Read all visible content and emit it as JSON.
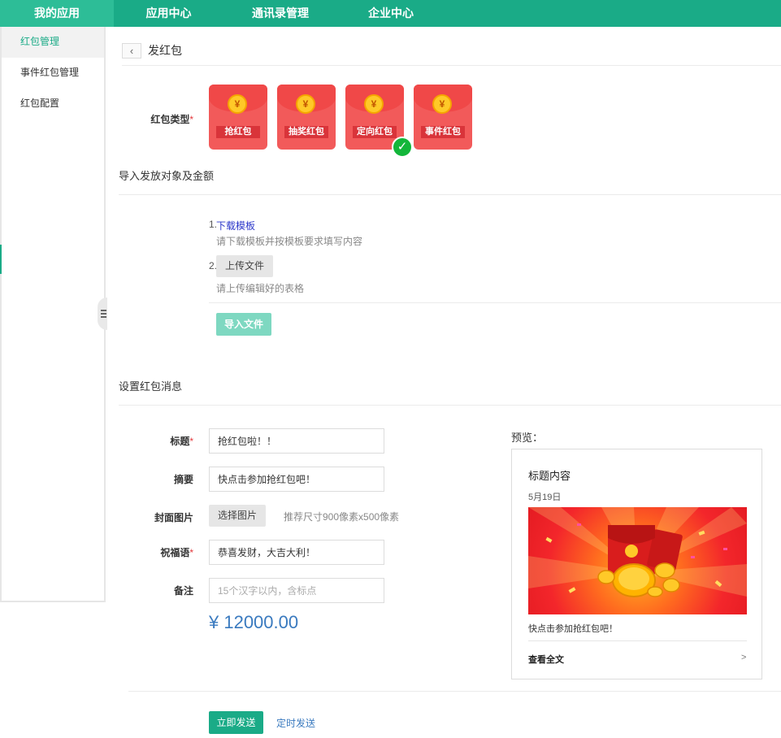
{
  "topnav": {
    "tabs": [
      "我的应用",
      "应用中心",
      "通讯录管理",
      "企业中心"
    ]
  },
  "sidebar": {
    "items": [
      "红包管理",
      "事件红包管理",
      "红包配置"
    ]
  },
  "page": {
    "title": "发红包",
    "back_icon": "chevron-left-icon"
  },
  "packet_type": {
    "label": "红包类型",
    "required_mark": "*",
    "coin_symbol": "¥",
    "options": [
      "抢红包",
      "抽奖红包",
      "定向红包",
      "事件红包"
    ],
    "selected_index": 2,
    "check_symbol": "✓"
  },
  "import_section": {
    "title": "导入发放对象及金额",
    "step1_num": "1.",
    "step1_link": "下载模板",
    "step1_hint": "请下载模板并按模板要求填写内容",
    "step2_num": "2.",
    "step2_button": "上传文件",
    "step2_hint": "请上传编辑好的表格",
    "import_button": "导入文件"
  },
  "message_section": {
    "title": "设置红包消息",
    "title_label": "标题",
    "title_value": "抢红包啦！！",
    "summary_label": "摘要",
    "summary_value": "快点击参加抢红包吧！",
    "cover_label": "封面图片",
    "cover_button": "选择图片",
    "cover_hint": "推荐尺寸900像素x500像素",
    "blessing_label": "祝福语",
    "blessing_value": "恭喜发财，大吉大利！",
    "remark_label": "备注",
    "remark_placeholder": "15个汉字以内，含标点",
    "amount": "¥ 12000.00",
    "required_mark": "*"
  },
  "preview": {
    "label": "预览：",
    "title": "标题内容",
    "date": "5月19日",
    "summary": "快点击参加抢红包吧！",
    "read_all": "查看全文",
    "arrow": ">"
  },
  "actions": {
    "send_now": "立即发送",
    "send_timed": "定时发送"
  },
  "colors": {
    "brand": "#1aab87",
    "packet": "#f25a5a",
    "link": "#3a7abf"
  }
}
